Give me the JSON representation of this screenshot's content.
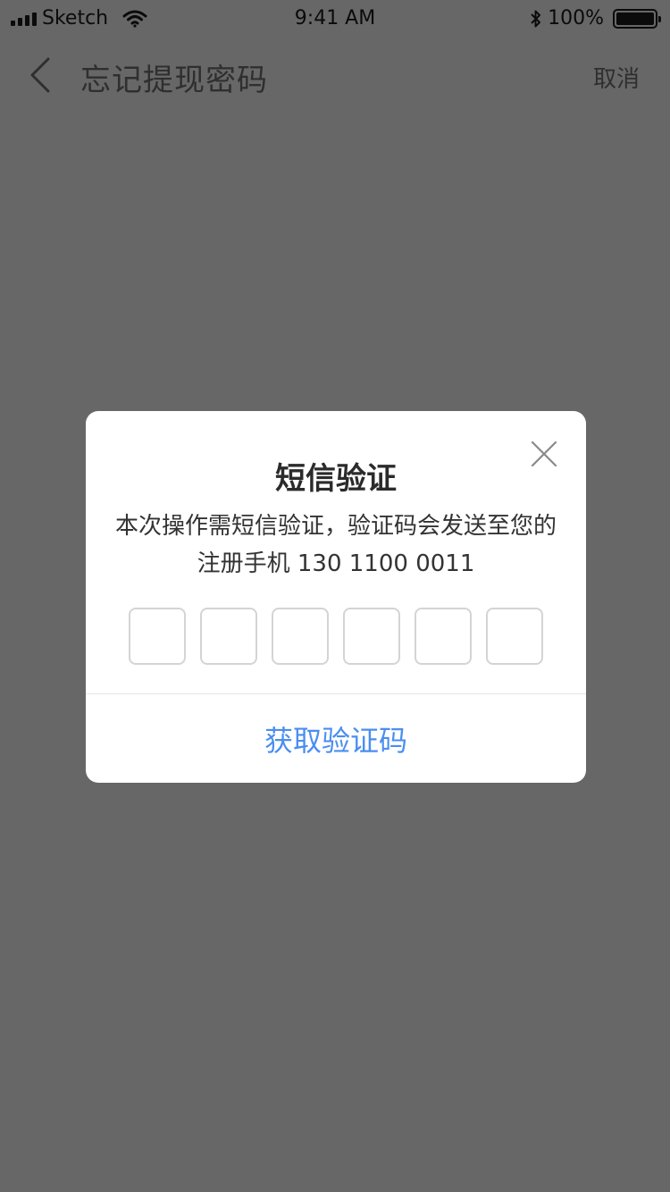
{
  "status_bar": {
    "carrier": "Sketch",
    "time": "9:41 AM",
    "battery_percent": "100%",
    "battery_level": 1.0,
    "icons": [
      "signal-icon",
      "wifi-icon",
      "bluetooth-icon",
      "battery-icon"
    ]
  },
  "nav": {
    "back_icon": "chevron-left-icon",
    "title": "忘记提现密码",
    "cancel_label": "取消"
  },
  "dialog": {
    "close_icon": "close-icon",
    "title": "短信验证",
    "description": "本次操作需短信验证，验证码会发送至您的注册手机 130 1100 0011",
    "code_boxes": [
      "",
      "",
      "",
      "",
      "",
      ""
    ],
    "get_code_label": "获取验证码"
  },
  "colors": {
    "overlay": "#676767",
    "dialog_bg": "#ffffff",
    "accent": "#4a8ef0",
    "code_border": "#d4d4d4"
  }
}
